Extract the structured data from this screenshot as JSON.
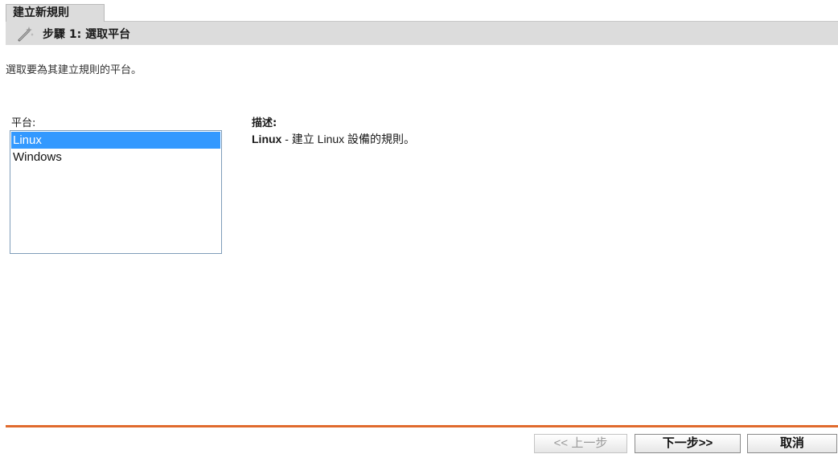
{
  "page": {
    "tab_title": "建立新規則",
    "step_title": "步驟 1:  選取平台",
    "instruction": "選取要為其建立規則的平台。"
  },
  "platform": {
    "label": "平台:",
    "options": [
      "Linux",
      "Windows"
    ],
    "selected": "Linux"
  },
  "description": {
    "label": "描述:",
    "platform_name": "Linux",
    "text": " - 建立 Linux 設備的規則。"
  },
  "buttons": {
    "prev_label": "<< 上一步",
    "next_label": "下一步>>",
    "cancel_label": "取消"
  },
  "colors": {
    "header_bg": "#dcdcdc",
    "selection": "#3399ff",
    "divider": "#e06a2d"
  },
  "icons": {
    "step": "wand-icon"
  }
}
